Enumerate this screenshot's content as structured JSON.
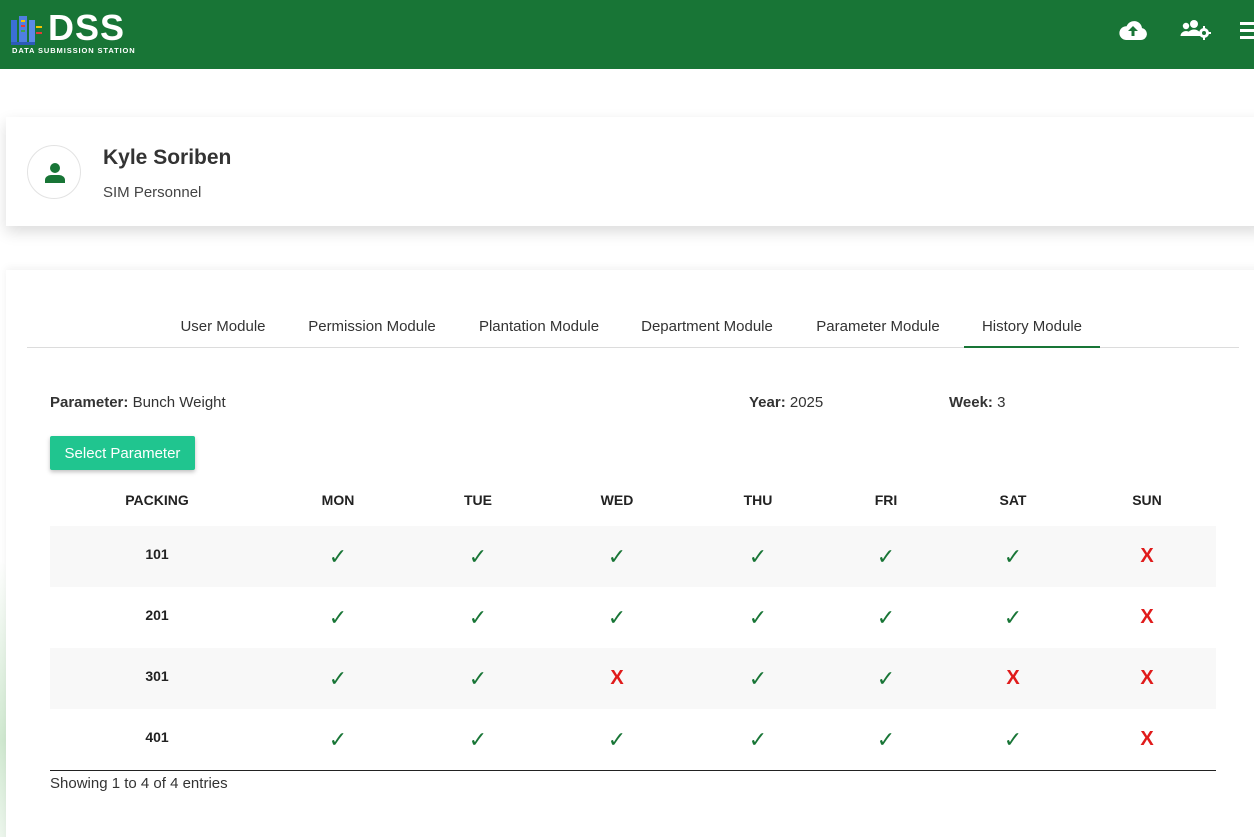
{
  "header": {
    "logo_text": "DSS",
    "logo_subtitle": "DATA SUBMISSION STATION",
    "bg_color": "#187536",
    "icons": [
      "cloud-upload-icon",
      "users-settings-icon",
      "menu-icon"
    ]
  },
  "profile": {
    "name": "Kyle Soriben",
    "role": "SIM Personnel",
    "avatar_icon": "user-icon"
  },
  "tabs": [
    {
      "label": "User Module",
      "active": false
    },
    {
      "label": "Permission Module",
      "active": false
    },
    {
      "label": "Plantation Module",
      "active": false
    },
    {
      "label": "Department Module",
      "active": false
    },
    {
      "label": "Parameter Module",
      "active": false
    },
    {
      "label": "History Module",
      "active": true
    }
  ],
  "filters": {
    "parameter_label": "Parameter:",
    "parameter_value": "Bunch Weight",
    "year_label": "Year:",
    "year_value": "2025",
    "week_label": "Week:",
    "week_value": "3"
  },
  "select_button_label": "Select Parameter",
  "table": {
    "columns": [
      "PACKING",
      "MON",
      "TUE",
      "WED",
      "THU",
      "FRI",
      "SAT",
      "SUN"
    ],
    "rows": [
      {
        "packing": "101",
        "days": [
          "✓",
          "✓",
          "✓",
          "✓",
          "✓",
          "✓",
          "X"
        ]
      },
      {
        "packing": "201",
        "days": [
          "✓",
          "✓",
          "✓",
          "✓",
          "✓",
          "✓",
          "X"
        ]
      },
      {
        "packing": "301",
        "days": [
          "✓",
          "✓",
          "X",
          "✓",
          "✓",
          "X",
          "X"
        ]
      },
      {
        "packing": "401",
        "days": [
          "✓",
          "✓",
          "✓",
          "✓",
          "✓",
          "✓",
          "X"
        ]
      }
    ],
    "check_color": "#187536",
    "cross_color": "#e01b1b"
  },
  "footer_info": "Showing 1 to 4 of 4 entries",
  "colors": {
    "accent_green": "#187536",
    "button_teal": "#20c58f"
  }
}
